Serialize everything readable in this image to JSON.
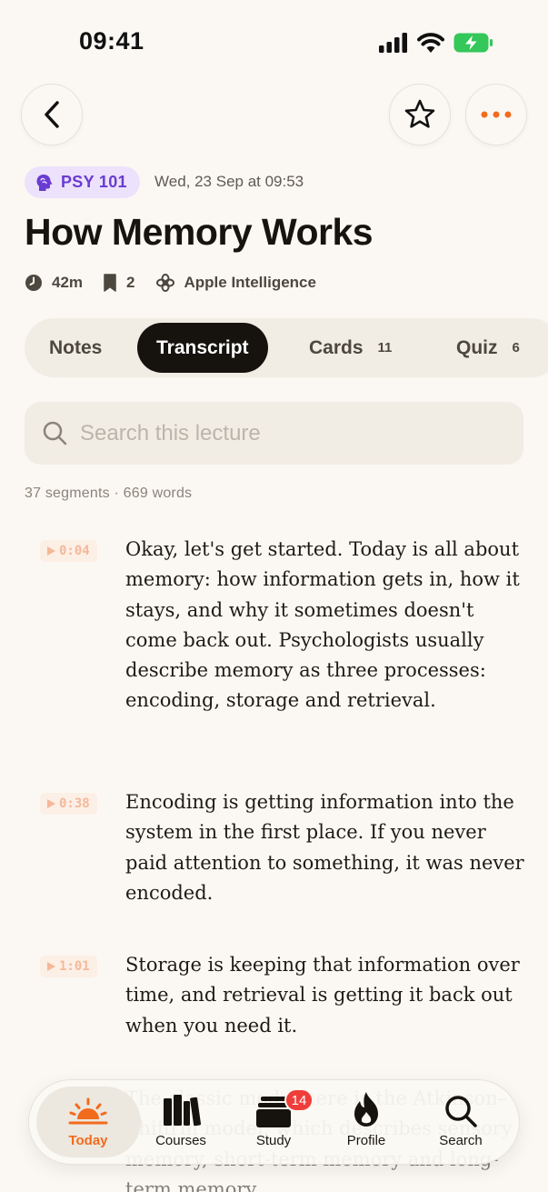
{
  "status_bar": {
    "time": "09:41"
  },
  "header": {
    "course_code": "PSY 101",
    "date": "Wed, 23 Sep at 09:53",
    "title": "How Memory Works",
    "duration": "42m",
    "bookmarks": "2",
    "ai_label": "Apple Intelligence"
  },
  "tabs": [
    {
      "label": "Notes",
      "count": ""
    },
    {
      "label": "Transcript",
      "count": ""
    },
    {
      "label": "Cards",
      "count": "11"
    },
    {
      "label": "Quiz",
      "count": "6"
    }
  ],
  "active_tab": "Transcript",
  "search": {
    "placeholder": "Search this lecture",
    "value": ""
  },
  "summary": "37 segments · 669 words",
  "segments": [
    {
      "time": "0:04",
      "text": "Okay, let's get started. Today is all about memory: how information gets in, how it stays, and why it sometimes doesn't come back out. Psychologists usually describe memory as three processes: encoding, storage and retrieval."
    },
    {
      "time": "0:38",
      "text": "Encoding is getting information into the system in the first place. If you never paid attention to something, it was never encoded."
    },
    {
      "time": "1:01",
      "text": "Storage is keeping that information over time, and retrieval is getting it back out when you need it."
    },
    {
      "time": "",
      "text": "The classic model here is the Atkinson–Shiffrin model, which describes sensory memory, short-term memory and long-term memory"
    }
  ],
  "tab_bar": {
    "items": [
      {
        "label": "Today",
        "icon": "sunrise-icon"
      },
      {
        "label": "Courses",
        "icon": "books-icon"
      },
      {
        "label": "Study",
        "icon": "stack-icon",
        "badge": "14"
      },
      {
        "label": "Profile",
        "icon": "flame-icon"
      },
      {
        "label": "Search",
        "icon": "search-icon"
      }
    ],
    "active": "Today"
  },
  "colors": {
    "accent": "#f26b1d",
    "badge_bg": "#ece2fb",
    "badge_text": "#6a3bd1",
    "notification": "#ef3d3a",
    "battery": "#34c759"
  }
}
